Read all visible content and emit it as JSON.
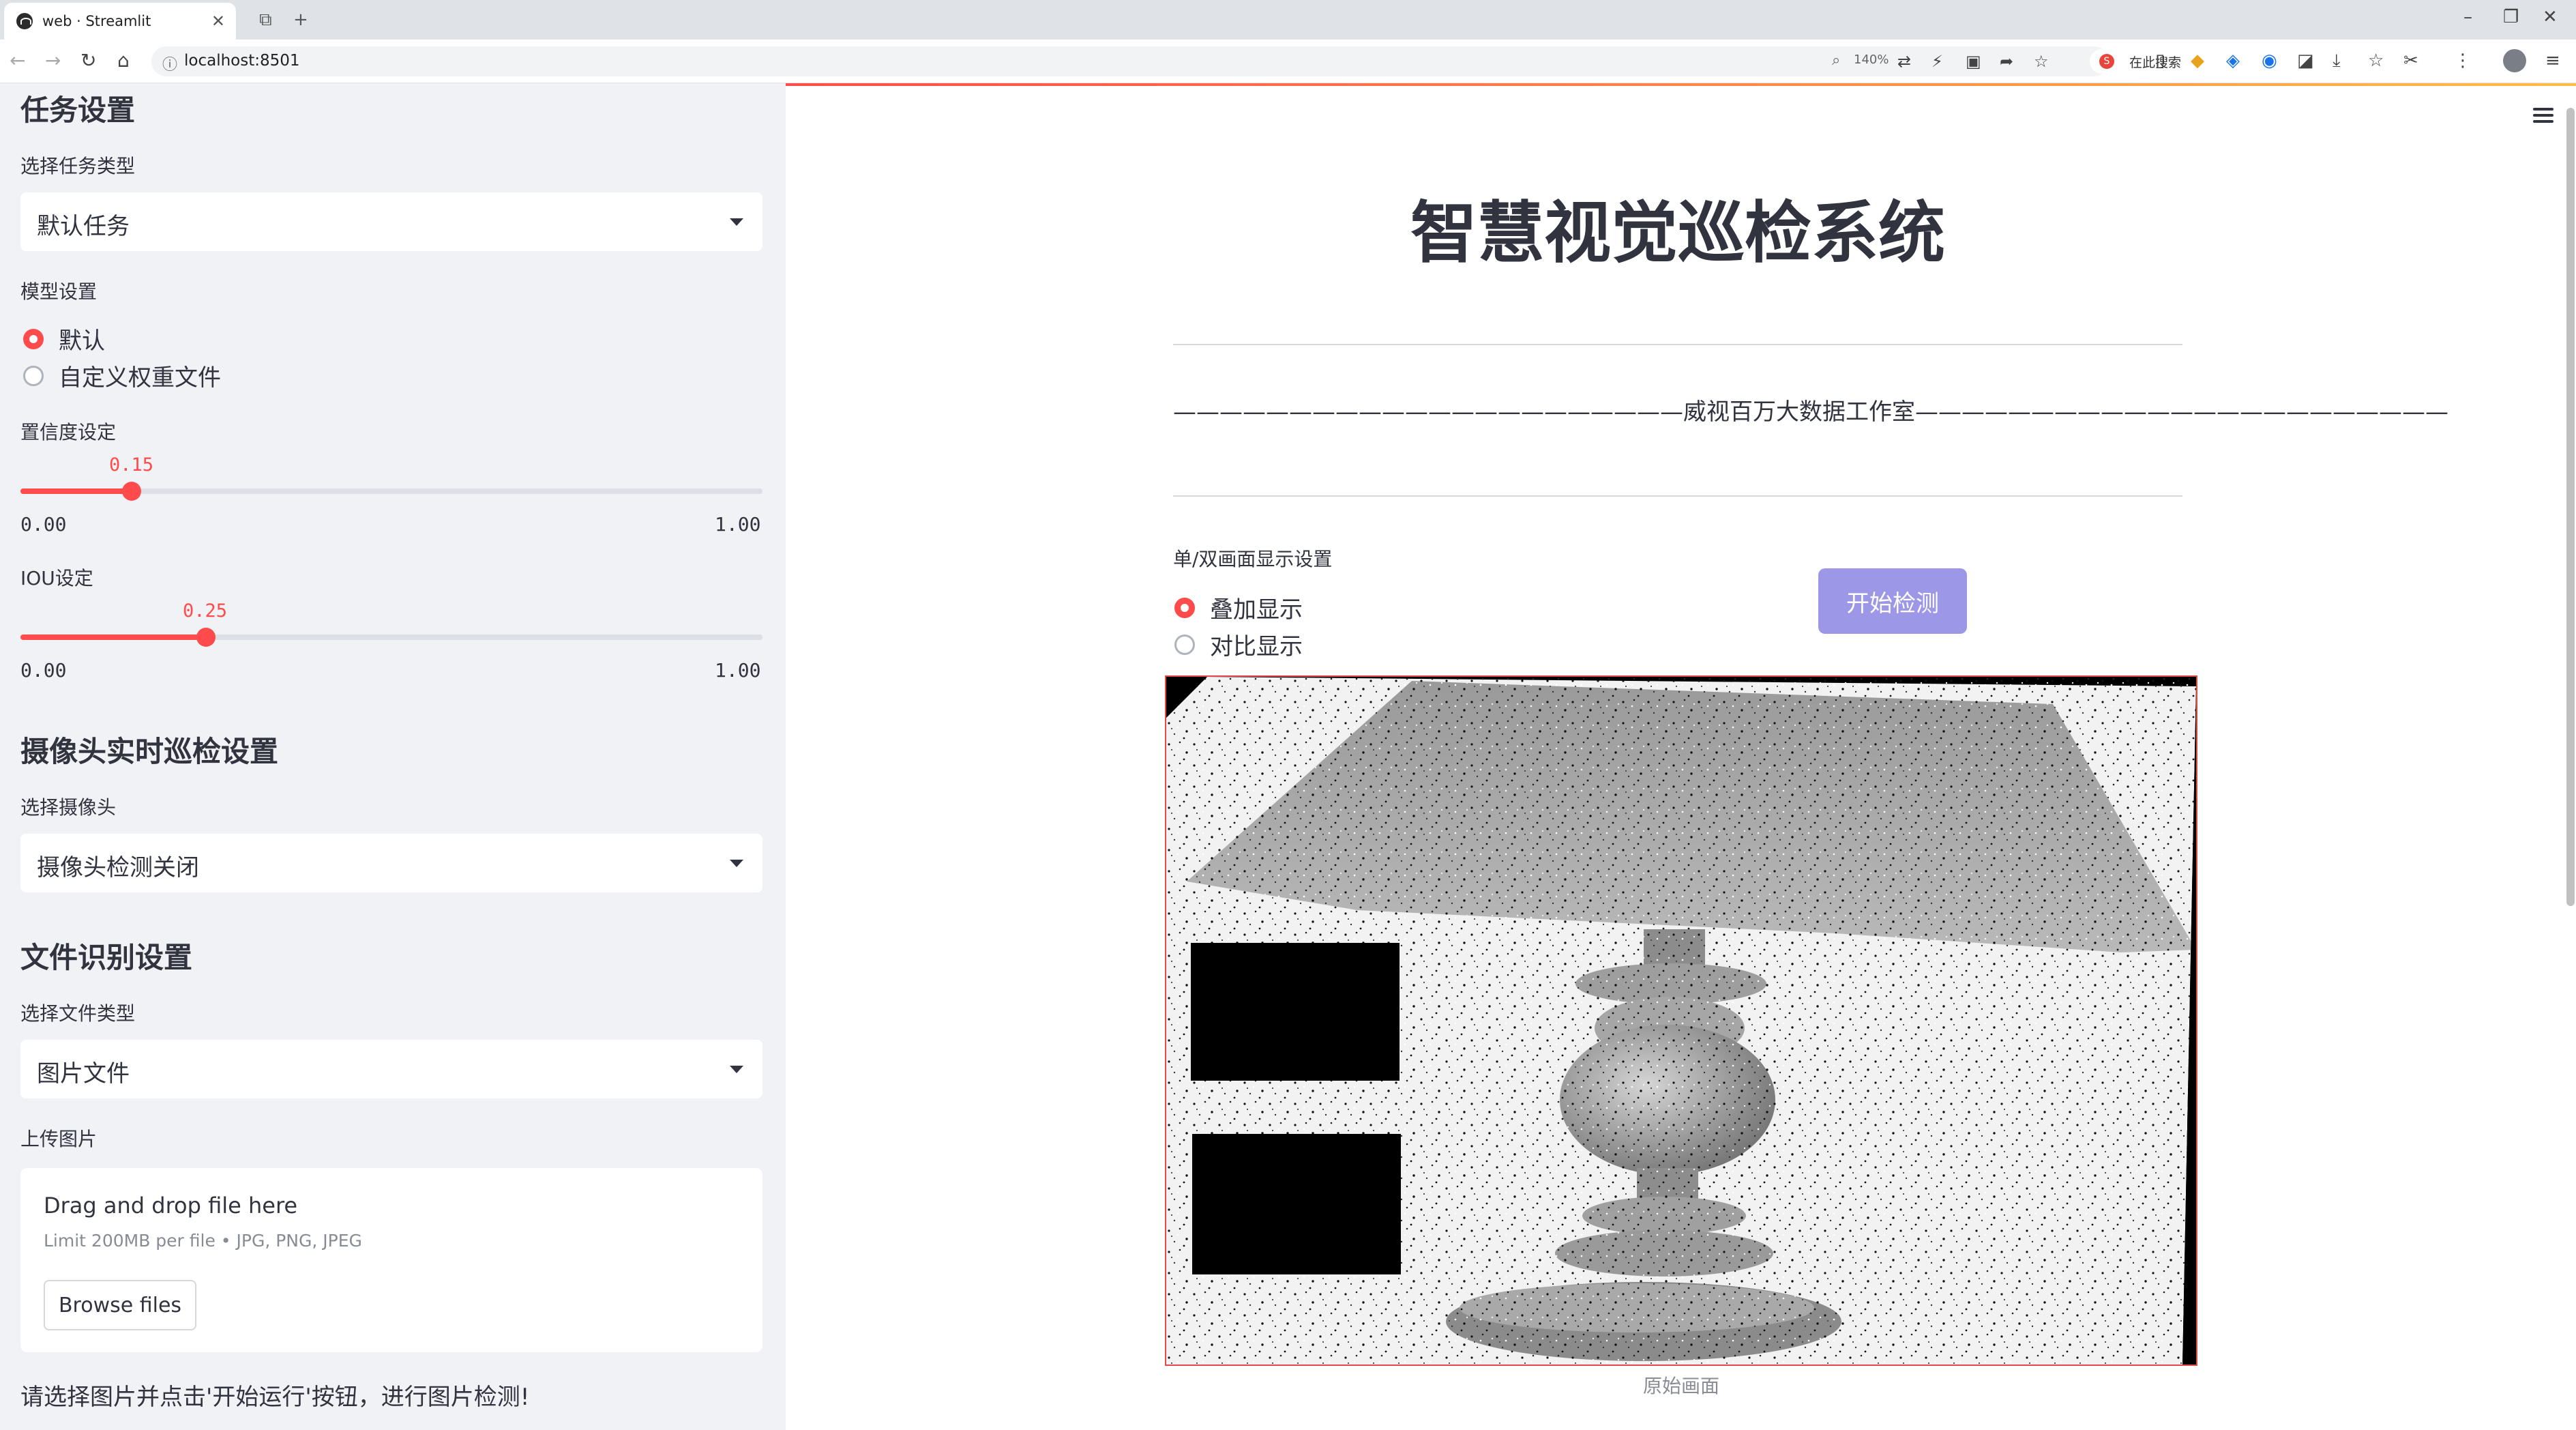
{
  "browser": {
    "tab_title": "web · Streamlit",
    "url": "localhost:8501",
    "zoom": "140%",
    "search_placeholder": "在此搜索"
  },
  "sidebar": {
    "task_section": {
      "heading": "任务设置",
      "task_type_label": "选择任务类型",
      "task_type_value": "默认任务",
      "model_label": "模型设置",
      "model_options": [
        "默认",
        "自定义权重文件"
      ],
      "model_selected": "默认",
      "confidence": {
        "label": "置信度设定",
        "value": "0.15",
        "min": "0.00",
        "max": "1.00",
        "fraction": 0.15
      },
      "iou": {
        "label": "IOU设定",
        "value": "0.25",
        "min": "0.00",
        "max": "1.00",
        "fraction": 0.25
      }
    },
    "camera_section": {
      "heading": "摄像头实时巡检设置",
      "camera_label": "选择摄像头",
      "camera_value": "摄像头检测关闭"
    },
    "file_section": {
      "heading": "文件识别设置",
      "file_type_label": "选择文件类型",
      "file_type_value": "图片文件",
      "upload_label": "上传图片",
      "dropzone_title": "Drag and drop file here",
      "dropzone_limit": "Limit 200MB per file • JPG, PNG, JPEG",
      "browse_label": "Browse files"
    },
    "note": "请选择图片并点击'开始运行'按钮，进行图片检测!"
  },
  "main": {
    "title": "智慧视觉巡检系统",
    "studio_line": "——————————————————————威视百万大数据工作室———————————————————————",
    "display_label": "单/双画面显示设置",
    "display_options": [
      "叠加显示",
      "对比显示"
    ],
    "display_selected": "叠加显示",
    "start_button": "开始检测",
    "image_caption": "原始画面"
  },
  "colors": {
    "accent": "#ff4b4b",
    "start_button": "#9c98e7",
    "sidebar_bg": "#f0f2f6"
  }
}
